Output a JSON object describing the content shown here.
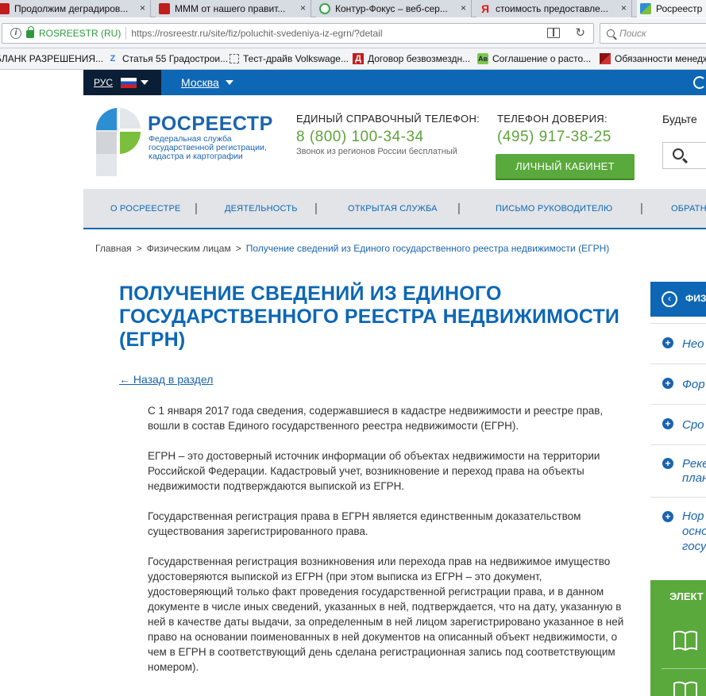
{
  "browser": {
    "tabs": [
      {
        "label": "Продолжим деградиров...",
        "favicon": "red-square-icon"
      },
      {
        "label": "МММ от нашего правит...",
        "favicon": "red-square-icon"
      },
      {
        "label": "Контур-Фокус – веб-сер...",
        "favicon": "kontur-icon"
      },
      {
        "label": "стоимость предоставле...",
        "favicon": "yandex-icon"
      },
      {
        "label": "Росреестр",
        "favicon": "rosreestr-icon"
      }
    ],
    "tab_close_glyph": "×",
    "site_identity": "ROSREESTR (RU)",
    "url": "https://rosreestr.ru/site/fiz/poluchit-svedeniya-iz-egrn/?detail",
    "search_placeholder": "Поиск",
    "bookmarks": [
      {
        "label": "БЛАНК РАЗРЕШЕНИЯ...",
        "glyph": ""
      },
      {
        "label": "Статья 55 Градострои...",
        "glyph": "Z"
      },
      {
        "label": "Тест-драйв Volkswage...",
        "glyph": ""
      },
      {
        "label": "Договор безвозмездн...",
        "glyph": "Д"
      },
      {
        "label": "Соглашение о расто...",
        "glyph": "Ав"
      },
      {
        "label": "Обязанности менедж",
        "glyph": ""
      }
    ]
  },
  "site": {
    "lang": "РУС",
    "city": "Москва",
    "logo_title": "РОСРЕЕСТР",
    "logo_sub": [
      "Федеральная служба",
      "государственной регистрации,",
      "кадастра и картографии"
    ],
    "phone_label": "ЕДИНЫЙ СПРАВОЧНЫЙ ТЕЛЕФОН:",
    "phone_number": "8 (800) 100-34-34",
    "phone_note": "Звонок из регионов России бесплатный",
    "trust_label": "ТЕЛЕФОН ДОВЕРИЯ:",
    "trust_number": "(495) 917-38-25",
    "cabinet_button": "ЛИЧНЫЙ КАБИНЕТ",
    "beyond_label": "Будьте",
    "nav": [
      "О РОСРЕЕСТРЕ",
      "ДЕЯТЕЛЬНОСТЬ",
      "ОТКРЫТАЯ СЛУЖБА",
      "ПИСЬМО РУКОВОДИТЕЛЮ",
      "ОБРАТНА"
    ],
    "nav_separator": "|",
    "accent": "#0d67b5",
    "green": "#5aa93c"
  },
  "breadcrumbs": {
    "items": [
      "Главная",
      "Физическим лицам",
      "Получение сведений из Единого государственного реестра недвижимости (ЕГРН)"
    ],
    "separator": ">"
  },
  "article": {
    "title": "ПОЛУЧЕНИЕ СВЕДЕНИЙ ИЗ ЕДИНОГО ГОСУДАРСТВЕННОГО РЕЕСТРА НЕДВИЖИМОСТИ (ЕГРН)",
    "back_link": "← Назад в раздел",
    "paragraphs": [
      "С 1 января 2017 года сведения, содержавшиеся в кадастре недвижимости и реестре прав, вошли в состав Единого государственного реестра недвижимости (ЕГРН).",
      "ЕГРН – это достоверный источник информации об объектах недвижимости на территории Российской Федерации. Кадастровый учет, возникновение и переход права на объекты недвижимости подтверждаются выпиской из ЕГРН.",
      "Государственная регистрация права в ЕГРН является единственным доказательством существования зарегистрированного права.",
      "Государственная регистрация возникновения или перехода прав на недвижимое имущество удостоверяются выпиской из ЕГРН (при этом выписка из ЕГРН – это документ, удостоверяющий только факт проведения государственной регистрации права, и в данном документе в числе иных сведений, указанных в ней, подтверждается, что на дату, указанную в ней в качестве даты выдачи, за определенным в ней лицом зарегистрировано указанное в ней право на основании поименованных в ней документов на описанный объект недвижимости, о чем в ЕГРН в соответствующий день сделана регистрационная запись под соответствующим номером)."
    ]
  },
  "sidebar": {
    "head_label": "ФИЗ",
    "back_glyph": "‹",
    "plus_glyph": "+",
    "items": [
      {
        "lines": [
          "Нео"
        ]
      },
      {
        "lines": [
          "Фор"
        ]
      },
      {
        "lines": [
          "Сро"
        ]
      },
      {
        "lines": [
          "Реке",
          "план"
        ]
      },
      {
        "lines": [
          "Нор",
          "осно",
          "госу"
        ]
      }
    ],
    "green_label": "ЭЛЕКТ"
  }
}
